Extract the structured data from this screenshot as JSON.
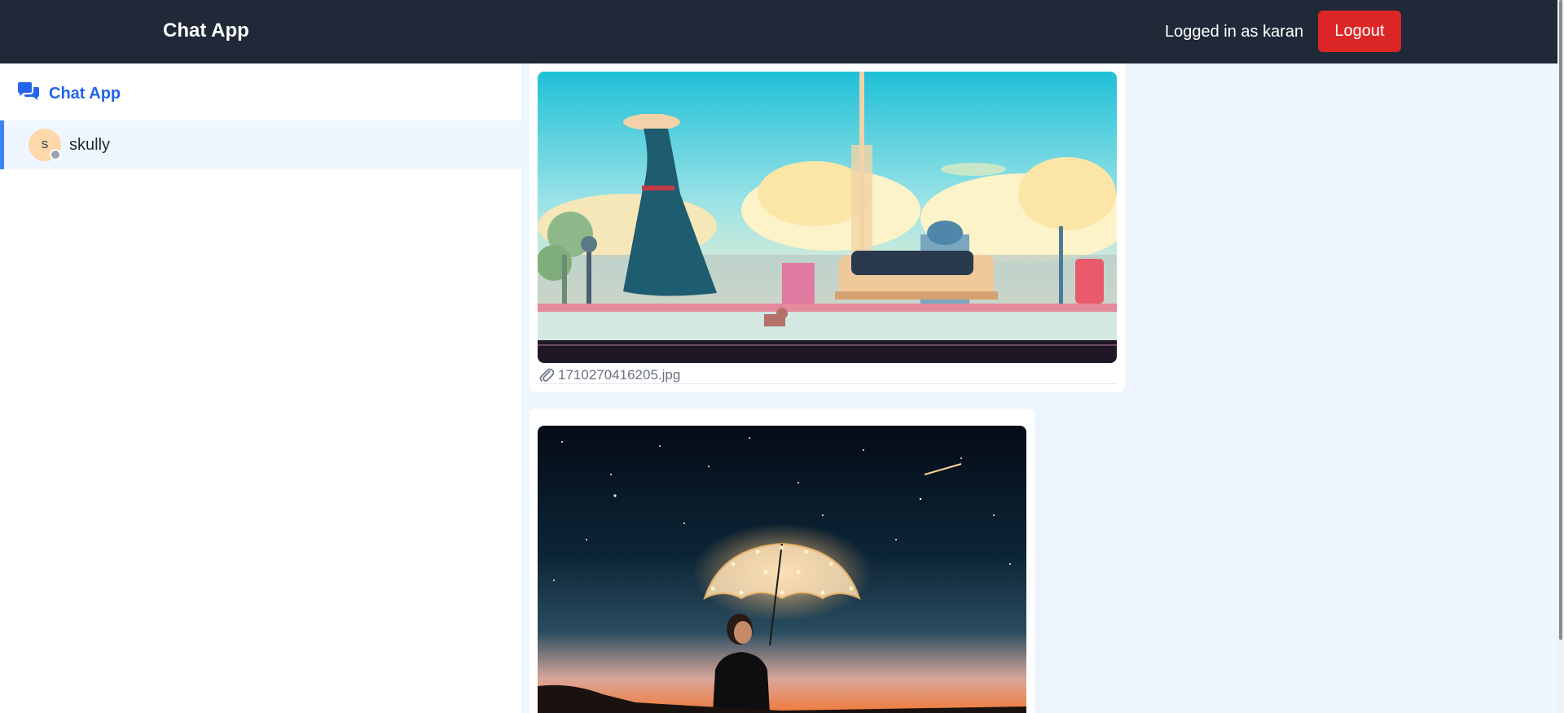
{
  "navbar": {
    "brand": "Chat App",
    "user_label": "Logged in as karan",
    "logout_label": "Logout"
  },
  "sidebar": {
    "title": "Chat App",
    "title_icon": "chat-bubbles-icon",
    "contacts": [
      {
        "name": "skully",
        "avatar_initial": "s",
        "status": "offline"
      }
    ]
  },
  "messages": [
    {
      "type": "image",
      "image": "pixel-art-city-girl-with-hat",
      "filename": "1710270416205.jpg",
      "attachment_icon": "paperclip-icon"
    },
    {
      "type": "image",
      "image": "woman-with-glowing-umbrella-night-sky"
    }
  ],
  "colors": {
    "navbar_bg": "#1f2937",
    "accent": "#2563eb",
    "logout": "#dc2626",
    "page_bg": "#eff5fd",
    "avatar_bg": "#fed7aa",
    "status_offline": "#9ca3af"
  }
}
